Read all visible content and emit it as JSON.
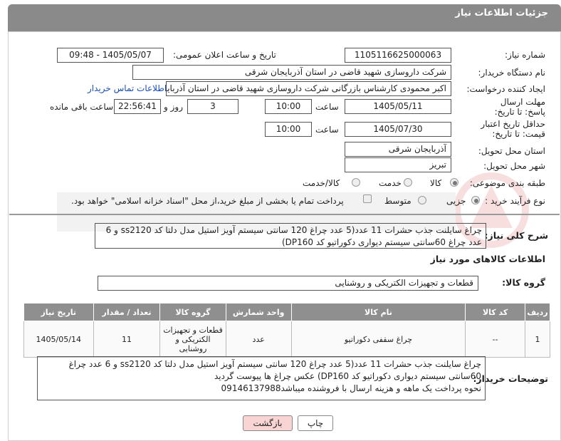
{
  "header": {
    "title": "جزئیات اطلاعات نیاز"
  },
  "form": {
    "need_number": {
      "label": "شماره نیاز:",
      "value": "1105116625000063"
    },
    "announce_datetime": {
      "label": "تاریخ و ساعت اعلان عمومی:",
      "value": "1405/05/07 - 09:48"
    },
    "buyer_org": {
      "label": "نام دستگاه خریدار:",
      "value": "شرکت داروسازی شهید قاضی در استان آذربایجان شرقی"
    },
    "creator": {
      "label": "ایجاد کننده درخواست:",
      "value": "اکبر محمودی  کارشناس بازرگانی شرکت داروسازی شهید قاضی در استان آذربایجان",
      "contact_link": "اطلاعات تماس خریدار"
    },
    "reply_deadline": {
      "label": "مهلت ارسال پاسخ: تا تاریخ:",
      "date": "1405/05/11",
      "time_label": "ساعت",
      "time": "10:00",
      "days": "3",
      "days_label": "روز و",
      "remaining": "22:56:41",
      "remaining_label": "ساعت باقی مانده"
    },
    "price_validity": {
      "label": "حداقل تاریخ اعتبار قیمت: تا تاریخ:",
      "date": "1405/07/30",
      "time_label": "ساعت",
      "time": "10:00"
    },
    "delivery_province": {
      "label": "استان محل تحویل:",
      "value": "آذربایجان شرقی"
    },
    "delivery_city": {
      "label": "شهر محل تحویل:",
      "value": "تبریز"
    },
    "category": {
      "label": "طبقه بندی موضوعی:",
      "options": [
        "کالا",
        "خدمت",
        "کالا/خدمت"
      ],
      "selected": "کالا"
    },
    "purchase_type": {
      "label": "نوع فرآیند خرید :",
      "options": [
        "جزیی",
        "متوسط"
      ],
      "selected": "جزیی",
      "note": "پرداخت تمام یا بخشی از مبلغ خرید،از محل \"اسناد خزانه اسلامی\" خواهد بود."
    }
  },
  "summary": {
    "label": "شرح کلی نیاز:",
    "text": "چراغ سایلنت جذب حشرات 11 عدد(5 عدد چراغ 120 سانتی سیستم آویز  استیل مدل دلتا کد ss2120 و 6 عدد چراغ 60سانتی سیستم دیواری دکوراتیو کد DP160)"
  },
  "goods_section": {
    "title": "اطلاعات کالاهای مورد نیاز",
    "group_label": "گروه کالا:",
    "group_value": "قطعات و تجهیزات الکتریکی و روشنایی"
  },
  "table": {
    "headers": [
      "ردیف",
      "کد کالا",
      "نام کالا",
      "واحد شمارش",
      "گروه کالا",
      "تعداد / مقدار",
      "تاریخ نیاز"
    ],
    "rows": [
      {
        "row": "1",
        "code": "--",
        "name": "چراغ سقفی دکوراتیو",
        "unit": "عدد",
        "group": "قطعات و تجهیزات الکتریکی و روشنایی",
        "qty": "11",
        "date": "1405/05/14"
      }
    ]
  },
  "buyer_notes": {
    "label": "توضیحات خریدار:",
    "line1": "چراغ سایلنت جذب حشرات 11 عدد(5 عدد چراغ 120 سانتی سیستم آویز  استیل مدل دلتا کد ss2120 و 6 عدد چراغ",
    "line2": "60سانتی سیستم دیواری دکوراتیو کد DP160) عکس چراغ ها پیوست گردید",
    "line3": "نحوه پرداخت یک ماهه و هزینه ارسال با فروشنده میباشد09146137988"
  },
  "buttons": {
    "print": "چاپ",
    "back": "بازگشت"
  },
  "colors": {
    "header_bg": "#8a8a8a",
    "back_button_bg": "#f8d4d4",
    "link": "#1a4fb5"
  }
}
